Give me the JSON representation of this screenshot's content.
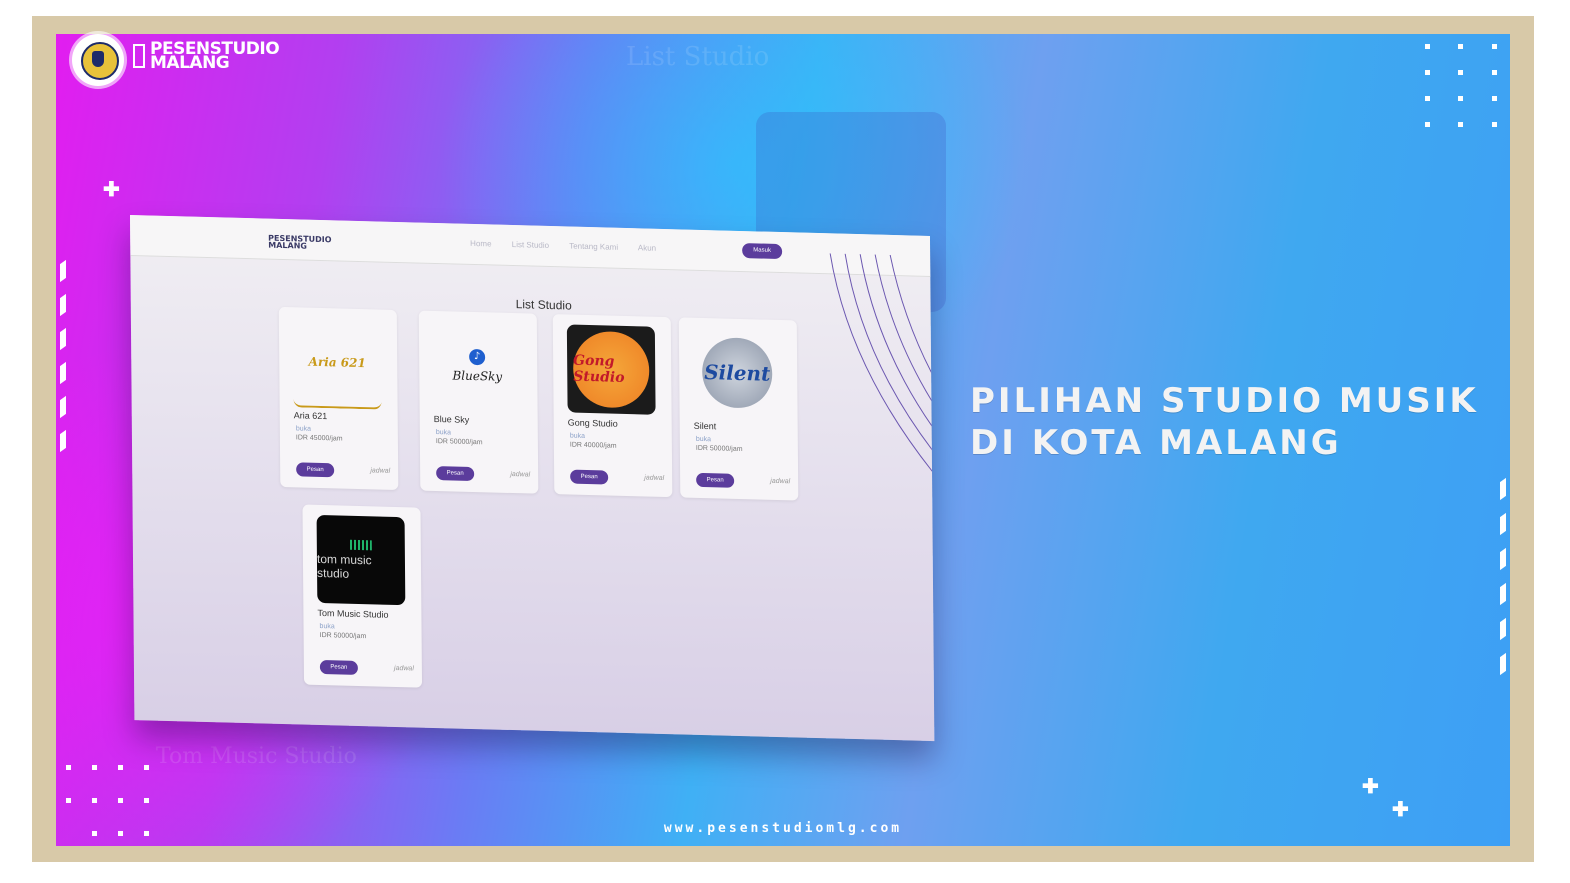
{
  "brand": {
    "line1": "PESENSTUDIO",
    "line2": "MALANG"
  },
  "headline": {
    "line1": "PILIHAN STUDIO MUSIK",
    "line2": "DI KOTA MALANG"
  },
  "website": "www.pesenstudiomlg.com",
  "background_ghost": {
    "title": "List Studio",
    "card": "Tom Music Studio"
  },
  "screenshot": {
    "nav_logo": {
      "line1": "PESENSTUDIO",
      "line2": "MALANG"
    },
    "nav_links": [
      "Home",
      "List Studio",
      "Tentang Kami",
      "Akun"
    ],
    "nav_button": "Masuk",
    "list_title": "List Studio",
    "studios": [
      {
        "name": "Aria 621",
        "status": "buka",
        "price": "IDR 45000/jam",
        "thumb_text": "Aria 621",
        "button": "Pesan",
        "link": "jadwal"
      },
      {
        "name": "Blue Sky",
        "status": "buka",
        "price": "IDR 50000/jam",
        "thumb_text": "BlueSky",
        "button": "Pesan",
        "link": "jadwal"
      },
      {
        "name": "Gong Studio",
        "status": "buka",
        "price": "IDR 40000/jam",
        "thumb_text": "Gong Studio",
        "button": "Pesan",
        "link": "jadwal"
      },
      {
        "name": "Silent",
        "status": "buka",
        "price": "IDR 50000/jam",
        "thumb_text": "Silent",
        "button": "Pesan",
        "link": "jadwal"
      },
      {
        "name": "Tom Music Studio",
        "status": "buka",
        "price": "IDR 50000/jam",
        "thumb_text": "tom music studio",
        "button": "Pesan",
        "link": "jadwal"
      }
    ]
  },
  "colors": {
    "accent": "#5b3c9c",
    "gradient_left": "#e21df0",
    "gradient_right": "#3d9ff5",
    "headline": "#f3f3f3"
  }
}
